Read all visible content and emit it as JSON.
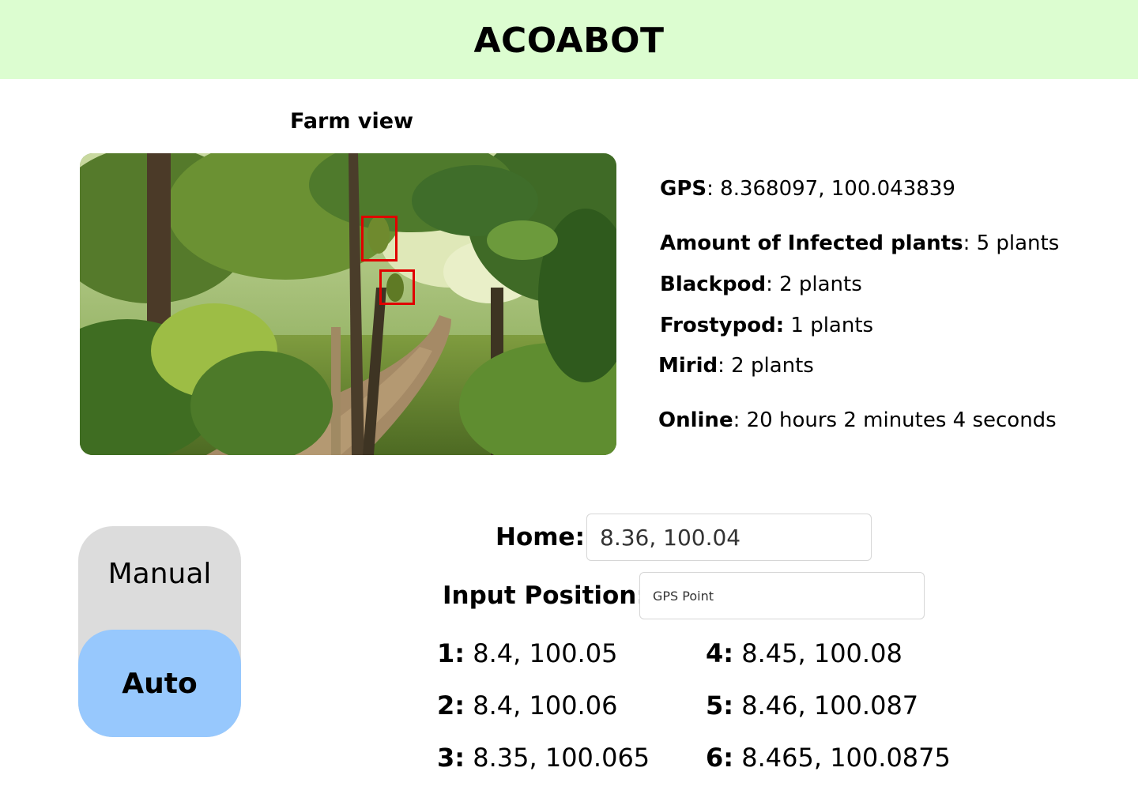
{
  "header": {
    "title": "ACOABOT",
    "background": "#dcfdd0"
  },
  "farm_view": {
    "title": "Farm view",
    "feed_description_icon": "camera-feed",
    "detection_color": "#e00000"
  },
  "stats": {
    "gps_label": "GPS",
    "gps_value": ": 8.368097, 100.043839",
    "infected_label": "Amount of Infected plants",
    "infected_value": ": 5 plants",
    "blackpod_label": "Blackpod",
    "blackpod_value": ": 2 plants",
    "frostypod_label": "Frostypod:",
    "frostypod_value": " 1 plants",
    "mirid_label": "Mirid",
    "mirid_value": ": 2 plants",
    "online_label": "Online",
    "online_value": ": 20 hours 2 minutes 4 seconds"
  },
  "mode": {
    "manual_label": "Manual",
    "auto_label": "Auto",
    "selected": "Auto",
    "selected_color": "#97c8fd",
    "toggle_color": "#dcdcdc"
  },
  "form": {
    "home_label": "Home:",
    "home_value": "8.36, 100.04",
    "input_position_label": "Input Position:",
    "input_position_placeholder": "GPS Point"
  },
  "waypoints": [
    {
      "num": "1:",
      "coords": " 8.4, 100.05"
    },
    {
      "num": "2:",
      "coords": " 8.4, 100.06"
    },
    {
      "num": "3:",
      "coords": " 8.35, 100.065"
    },
    {
      "num": "4:",
      "coords": " 8.45, 100.08"
    },
    {
      "num": "5:",
      "coords": " 8.46, 100.087"
    },
    {
      "num": "6:",
      "coords": " 8.465, 100.0875"
    }
  ]
}
